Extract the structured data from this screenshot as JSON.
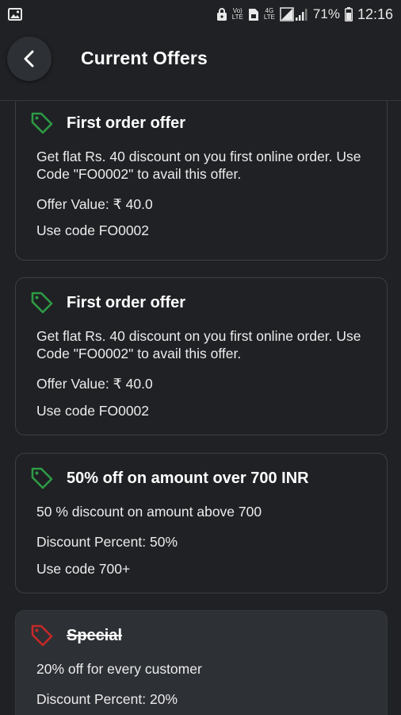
{
  "status_bar": {
    "lte_top": "Vo)",
    "lte_bottom": "LTE",
    "net_top": "4G",
    "net_bottom": "LTE",
    "battery": "71%",
    "time": "12:16"
  },
  "header": {
    "title": "Current Offers"
  },
  "offers": [
    {
      "title": "First order offer",
      "description": "Get flat Rs. 40 discount on you first online order. Use Code \"FO0002\" to avail this offer.",
      "value_line": "Offer Value: ₹ 40.0",
      "code_line": "Use code FO0002",
      "tag_color": "#2e9a45",
      "active": true
    },
    {
      "title": "First order offer",
      "description": "Get flat Rs. 40 discount on you first online order. Use Code \"FO0002\" to avail this offer.",
      "value_line": "Offer Value: ₹ 40.0",
      "code_line": "Use code FO0002",
      "tag_color": "#2e9a45",
      "active": true
    },
    {
      "title": "50% off on amount over 700 INR",
      "description": "50 % discount on amount  above 700",
      "value_line": "Discount Percent: 50%",
      "code_line": "Use code 700+",
      "tag_color": "#2e9a45",
      "active": true
    },
    {
      "title": "Special",
      "description": "20% off for every customer",
      "value_line": "Discount Percent: 20%",
      "tag_color": "#c62828",
      "active": false
    }
  ]
}
